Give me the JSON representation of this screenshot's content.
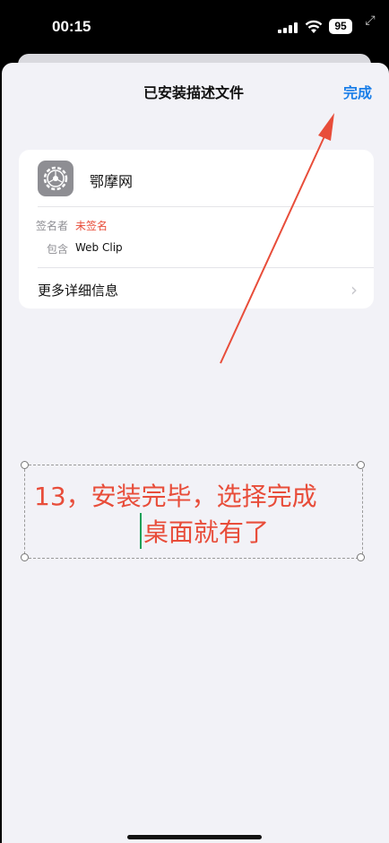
{
  "status_bar": {
    "time": "00:15",
    "battery": "95"
  },
  "sheet": {
    "title": "已安装描述文件",
    "done_label": "完成"
  },
  "profile": {
    "name": "鄂摩网",
    "signer_label": "签名者",
    "signer_value": "未签名",
    "contains_label": "包含",
    "contains_value": "Web Clip",
    "more_label": "更多详细信息"
  },
  "annotation": {
    "line1": "13，安装完毕，选择完成",
    "line2": "桌面就有了",
    "color": "#e84d3a"
  },
  "colors": {
    "accent": "#1a7ee8",
    "unsigned": "#e84d3a"
  }
}
